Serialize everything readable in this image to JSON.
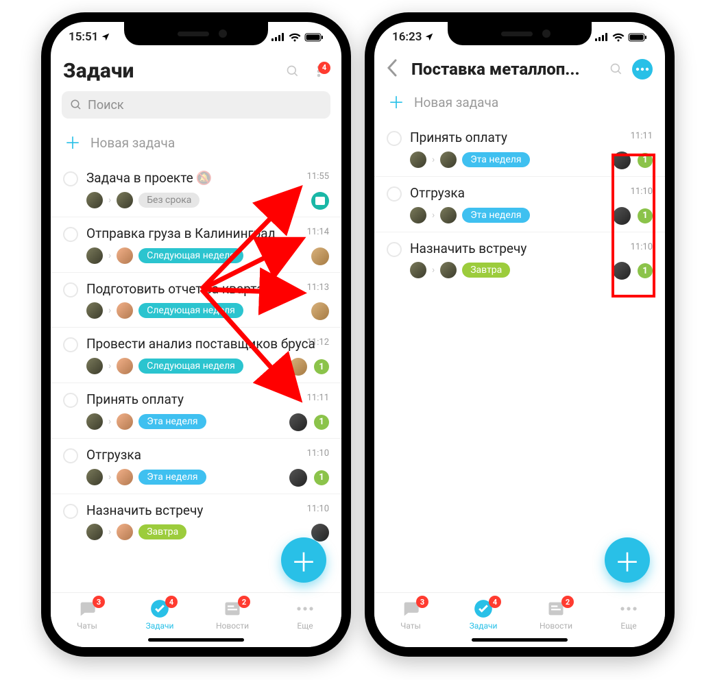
{
  "left": {
    "status": {
      "time": "15:51",
      "notif_count": "4"
    },
    "header_title": "Задачи",
    "search_placeholder": "Поиск",
    "new_task": "Новая задача",
    "tasks": [
      {
        "title": "Задача в проекте",
        "muted_icon": true,
        "chip": "Без срока",
        "chip_style": "grey",
        "time": "11:55",
        "proj": "teal",
        "count": null,
        "ava2": false
      },
      {
        "title": "Отправка груза в Калининград",
        "chip": "Следующая неделя",
        "chip_style": "teal",
        "time": "11:14",
        "proj": "wood",
        "count": null,
        "ava2": true
      },
      {
        "title": "Подготовить отчет за квартал",
        "chip": "Следующая неделя",
        "chip_style": "teal",
        "time": "11:13",
        "proj": "wood",
        "count": null,
        "ava2": true
      },
      {
        "title": "Провести анализ поставщиков бруса",
        "chip": "Следующая неделя",
        "chip_style": "teal",
        "time": "11:12",
        "proj": "wood",
        "count": "1",
        "ava2": true
      },
      {
        "title": "Принять оплату",
        "chip": "Эта неделя",
        "chip_style": "blue",
        "time": "11:11",
        "proj": "dark",
        "count": "1",
        "ava2": true
      },
      {
        "title": "Отгрузка",
        "chip": "Эта неделя",
        "chip_style": "blue",
        "time": "11:10",
        "proj": "dark",
        "count": "1",
        "ava2": true
      },
      {
        "title": "Назначить встречу",
        "chip": "Завтра",
        "chip_style": "green",
        "time": "11:10",
        "proj": "dark",
        "count": null,
        "ava2": true,
        "truncated": true
      }
    ]
  },
  "right": {
    "status": {
      "time": "16:23"
    },
    "header_title": "Поставка металлоп...",
    "new_task": "Новая задача",
    "tasks": [
      {
        "title": "Принять оплату",
        "chip": "Эта неделя",
        "chip_style": "blue",
        "time": "11:11",
        "count": "1"
      },
      {
        "title": "Отгрузка",
        "chip": "Эта неделя",
        "chip_style": "blue",
        "time": "11:10",
        "count": "1"
      },
      {
        "title": "Назначить встречу",
        "chip": "Завтра",
        "chip_style": "green",
        "time": "11:10",
        "count": "1"
      }
    ]
  },
  "tabs": {
    "chats": {
      "label": "Чаты",
      "badge": "3"
    },
    "tasks": {
      "label": "Задачи",
      "badge": "4"
    },
    "news": {
      "label": "Новости",
      "badge": "2"
    },
    "more": {
      "label": "Еще"
    }
  }
}
